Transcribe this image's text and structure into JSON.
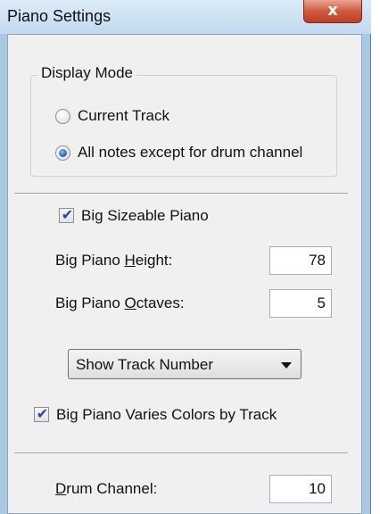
{
  "window": {
    "title": "Piano Settings",
    "close_label": "x"
  },
  "display_mode": {
    "legend": "Display Mode",
    "options": [
      {
        "label": "Current Track",
        "selected": false
      },
      {
        "label": "All notes except for drum channel",
        "selected": true
      }
    ]
  },
  "big_piano": {
    "sizeable_label": "Big Sizeable Piano",
    "sizeable_checked": true,
    "height_label_pre": "Big Piano ",
    "height_label_key": "H",
    "height_label_post": "eight:",
    "height_value": "78",
    "octaves_label_pre": "Big Piano ",
    "octaves_label_key": "O",
    "octaves_label_post": "ctaves:",
    "octaves_value": "5",
    "dropdown_selected": "Show Track Number",
    "varies_label": "Big Piano Varies Colors by Track",
    "varies_checked": true
  },
  "drum": {
    "label_key": "D",
    "label_post": "rum Channel:",
    "value": "10"
  }
}
